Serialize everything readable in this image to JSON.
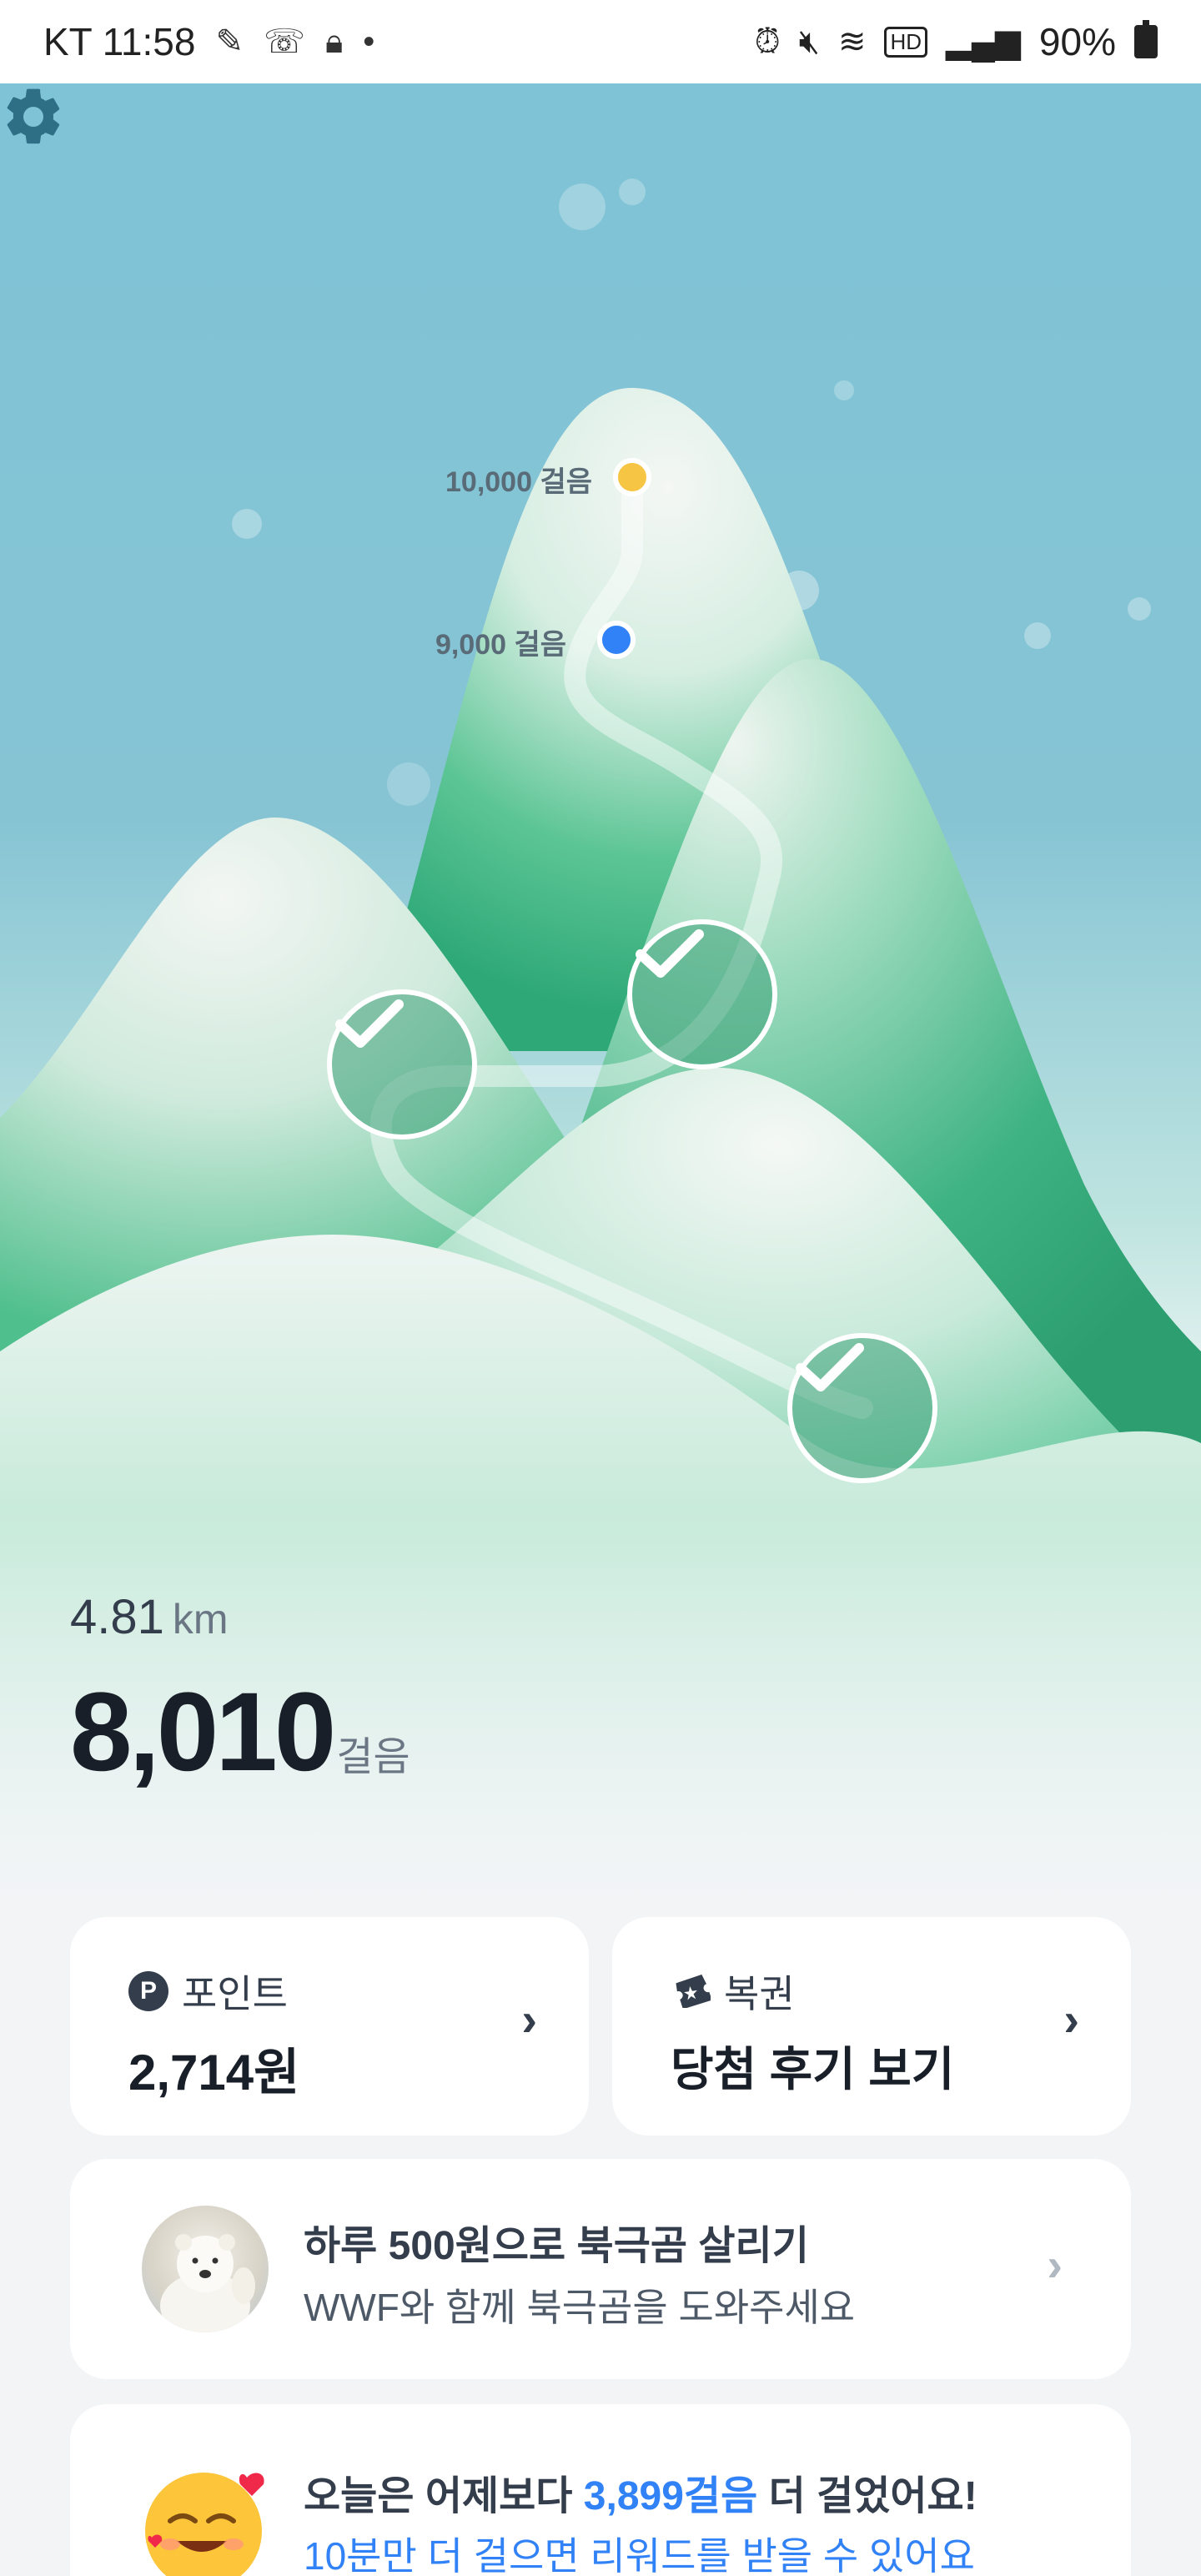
{
  "status_bar": {
    "carrier_time": "KT 11:58",
    "battery": "90%",
    "icons": [
      "notification-icon",
      "volte-icon",
      "lock-icon",
      "alarm-icon",
      "mute-icon",
      "wifi-icon",
      "hd-icon",
      "signal-icon",
      "battery-icon"
    ]
  },
  "hero": {
    "milestones": [
      {
        "label": "10,000 걸음",
        "color": "#f7c544"
      },
      {
        "label": "9,000 걸음",
        "color": "#3182f6"
      }
    ],
    "completed_checks": 3
  },
  "stats": {
    "distance_value": "4.81",
    "distance_unit": "km",
    "steps_value": "8,010",
    "steps_unit": "걸음"
  },
  "cards": {
    "points": {
      "label": "포인트",
      "value": "2,714원",
      "icon_letter": "P"
    },
    "lottery": {
      "label": "복권",
      "value": "당첨 후기 보기"
    }
  },
  "donate": {
    "title": "하루 500원으로 북극곰 살리기",
    "subtitle": "WWF와 함께 북극곰을 도와주세요"
  },
  "compare": {
    "prefix": "오늘은 어제보다 ",
    "highlight": "3,899걸음",
    "suffix": " 더 걸었어요!",
    "line2": "10분만 더 걸으면 리워드를 받을 수 있어요"
  },
  "colors": {
    "accent_blue": "#3182f6",
    "sky": "#7fc3d6",
    "mountain_green": "#3fb383"
  }
}
